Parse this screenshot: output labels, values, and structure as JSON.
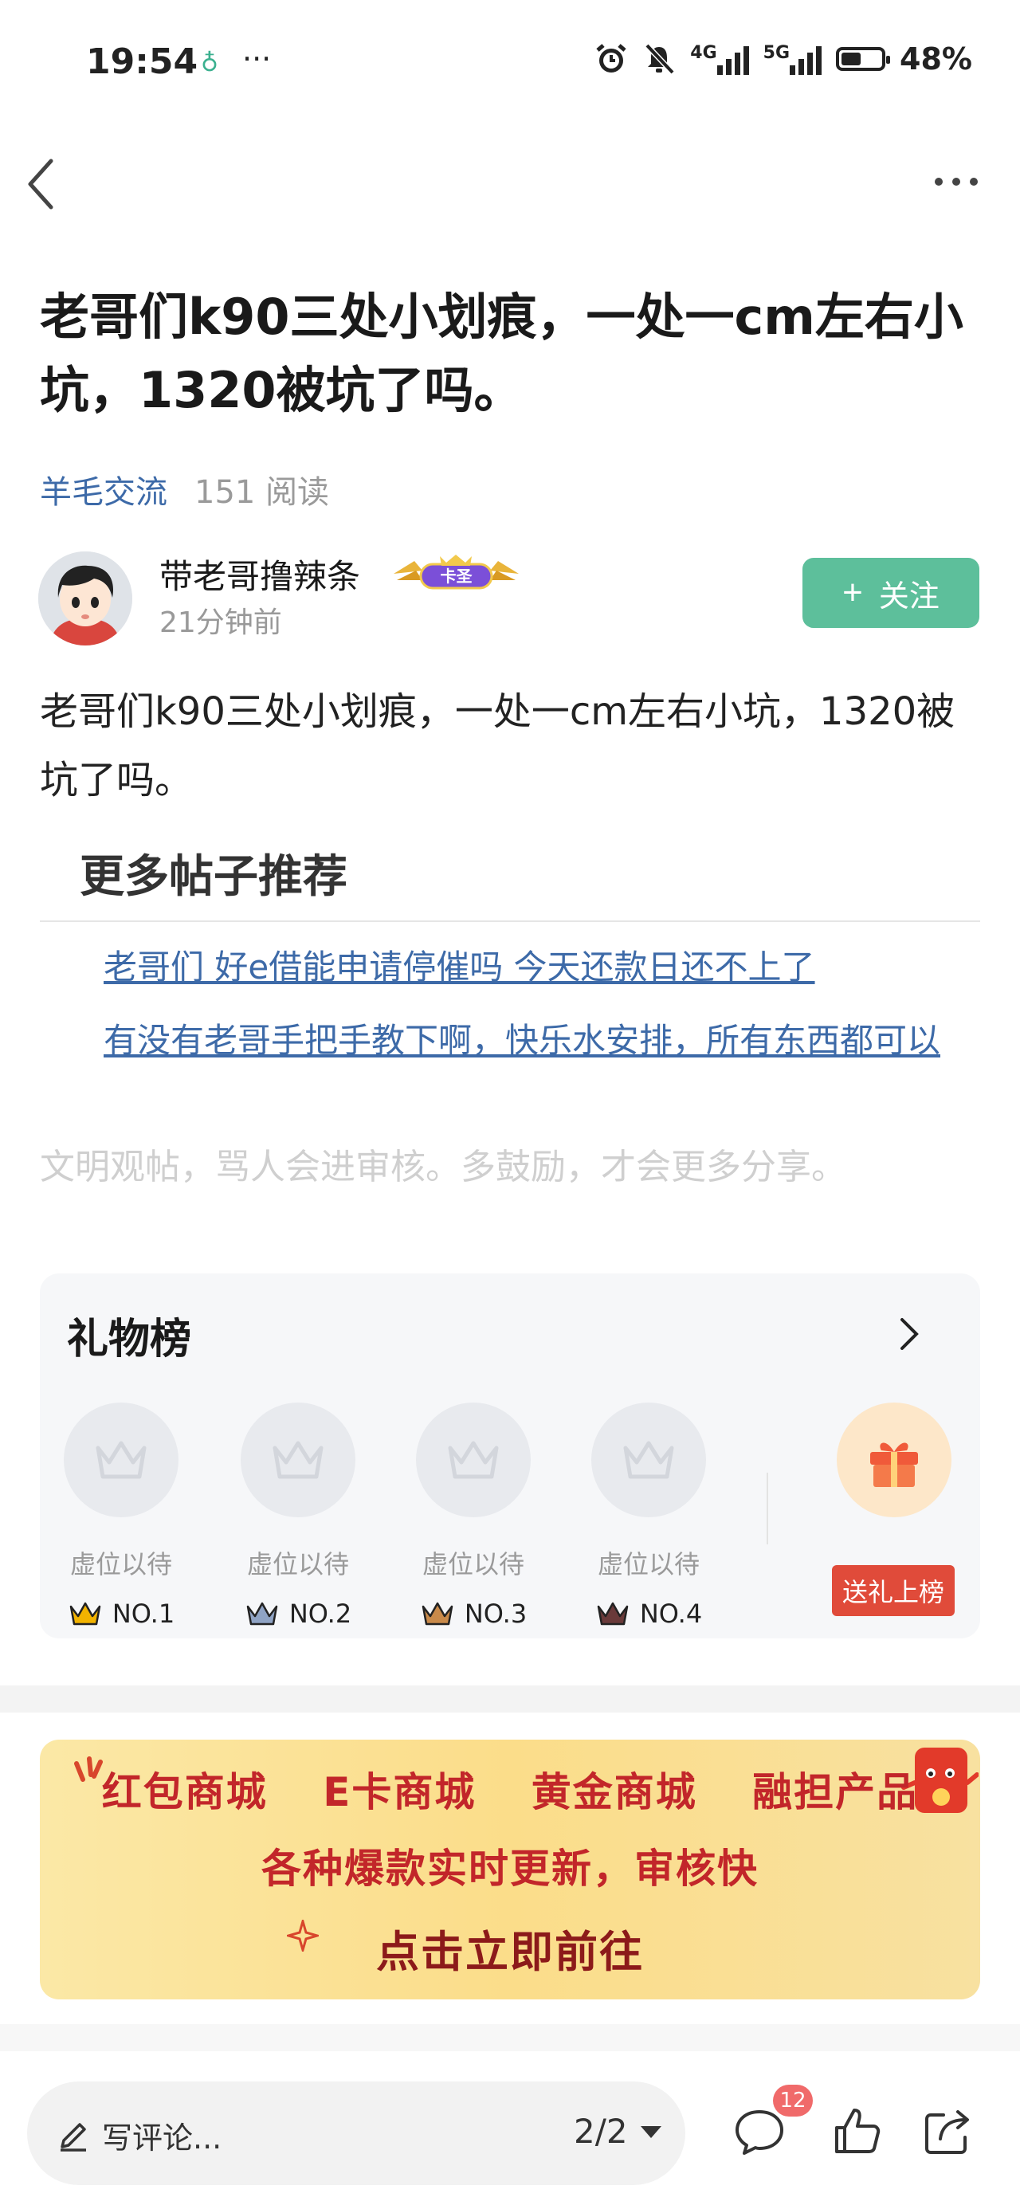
{
  "status_bar": {
    "time": "19:54",
    "extra": "···",
    "net1": "4G",
    "net2": "5G",
    "battery": "48%"
  },
  "post": {
    "title": "老哥们k90三处小划痕，一处一cm左右小坑，1320被坑了吗。",
    "category": "羊毛交流",
    "reads": "151 阅读",
    "author": "带老哥撸辣条",
    "badge": "卡圣",
    "time_ago": "21分钟前",
    "follow_label": "关注",
    "body": "老哥们k90三处小划痕，一处一cm左右小坑，1320被坑了吗。"
  },
  "recommend": {
    "title": "更多帖子推荐",
    "links": [
      "老哥们 好e借能申请停催吗 今天还款日还不上了",
      "有没有老哥手把手教下啊，快乐水安排，所有东西都可以"
    ]
  },
  "notice": "文明观帖，骂人会进审核。多鼓励，才会更多分享。",
  "gift_board": {
    "title": "礼物榜",
    "slots": [
      {
        "label": "虚位以待",
        "rank": "NO.1",
        "color": "#f2b300"
      },
      {
        "label": "虚位以待",
        "rank": "NO.2",
        "color": "#8fa3c4"
      },
      {
        "label": "虚位以待",
        "rank": "NO.3",
        "color": "#c98a4a"
      },
      {
        "label": "虚位以待",
        "rank": "NO.4",
        "color": "#6a3a3a"
      }
    ],
    "send_label": "送礼上榜"
  },
  "banner": {
    "line1": "红包商城 E卡商城 黄金商城 融担产品",
    "line2": "各种爆款实时更新，审核快",
    "line3": "点击立即前往"
  },
  "bottom_bar": {
    "comment_placeholder": "写评论...",
    "pager": "2/2",
    "comment_count": "12"
  }
}
